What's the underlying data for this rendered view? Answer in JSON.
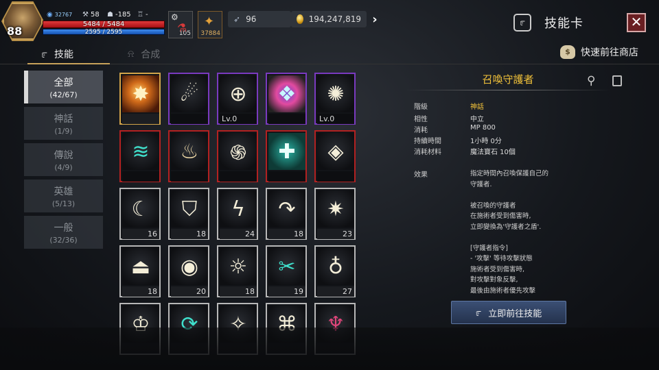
{
  "player": {
    "level": "88",
    "buff_value": "32767",
    "stat_a": "58",
    "stat_b": "-185",
    "stat_c": "-",
    "hp": "5484 / 5484",
    "mp": "2595 / 2595",
    "slot_gear_count": "105",
    "slot_flask_count": "37884"
  },
  "currency": {
    "gems": "96",
    "gold": "194,247,819"
  },
  "window": {
    "title": "技能卡",
    "close_label": "✕"
  },
  "tabs": [
    {
      "label": "技能",
      "active": true
    },
    {
      "label": "合成",
      "active": false
    }
  ],
  "shop_link": "快速前往商店",
  "categories": [
    {
      "name": "全部",
      "count": "(42/67)",
      "active": true
    },
    {
      "name": "神話",
      "count": "(1/9)",
      "active": false
    },
    {
      "name": "傳說",
      "count": "(4/9)",
      "active": false
    },
    {
      "name": "英雄",
      "count": "(5/13)",
      "active": false
    },
    {
      "name": "一般",
      "count": "(32/36)",
      "active": false
    }
  ],
  "cards": {
    "row1": [
      "",
      "",
      "Lv.0",
      "",
      "Lv.0"
    ],
    "row2": [
      "",
      "",
      "",
      "",
      ""
    ],
    "row3": [
      "16",
      "18",
      "24",
      "18",
      "23"
    ],
    "row4": [
      "18",
      "20",
      "18",
      "19",
      "27"
    ]
  },
  "detail": {
    "name": "召喚守護者",
    "fields": [
      {
        "key": "階級",
        "value": "神話"
      },
      {
        "key": "相性",
        "value": "中立"
      },
      {
        "key": "消耗",
        "value": "MP 800"
      },
      {
        "key": "持續時間",
        "value": "1小時 0分"
      },
      {
        "key": "消耗材料",
        "value": "魔法寶石 10個"
      }
    ],
    "effect_label": "效果",
    "effect_text": "指定時間內召喚保護自己的\n守護者.\n\n被召喚的守護者\n在施術者受到傷害時,\n立即變換為'守護者之盾'.\n\n[守護者指令]\n- '攻擊' 等待攻擊狀態\n施術者受到傷害時,\n對攻擊對象反擊,\n最後由施術者優先攻擊",
    "goto_button": "立即前往技能"
  },
  "icons": {
    "title": "spiral-icon",
    "search": "magnifier-icon",
    "lock": "lock-icon",
    "close": "x-icon",
    "shop": "money-bag-icon",
    "tab_skill": "spiral-icon",
    "tab_synth": "bell-icon"
  }
}
